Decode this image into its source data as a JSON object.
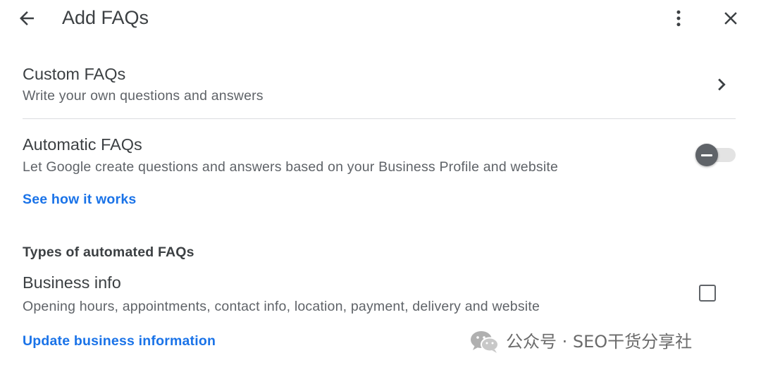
{
  "header": {
    "title": "Add FAQs",
    "back_icon": "arrow-back-icon",
    "more_icon": "more-vert-icon",
    "close_icon": "close-icon"
  },
  "custom_faqs": {
    "title": "Custom FAQs",
    "subtitle": "Write your own questions and answers",
    "chevron_icon": "chevron-right-icon"
  },
  "automatic_faqs": {
    "title": "Automatic FAQs",
    "subtitle": "Let Google create questions and answers based on your Business Profile and website",
    "link": "See how it works",
    "toggle_state": "off"
  },
  "types": {
    "heading": "Types of automated FAQs",
    "business_info": {
      "title": "Business info",
      "subtitle": "Opening hours, appointments, contact info, location, payment, delivery and website",
      "checked": false
    },
    "update_link": "Update business information"
  },
  "watermark": {
    "text": "公众号 · SEO干货分享社",
    "icon": "wechat-icon"
  },
  "colors": {
    "link": "#1a73e8",
    "text_primary": "#3c4043",
    "text_secondary": "#5f6368",
    "divider": "#dadce0"
  }
}
